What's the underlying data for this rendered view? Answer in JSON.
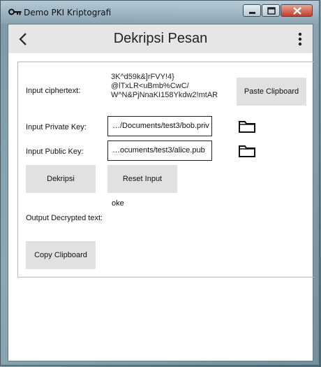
{
  "window": {
    "title": "Demo PKI Kriptografi"
  },
  "appbar": {
    "title": "Dekripsi Pesan",
    "back_icon": "arrow-left-icon",
    "menu_icon": "more-vertical-icon"
  },
  "form": {
    "ciphertext_label": "Input ciphertext:",
    "ciphertext_lines": [
      "3K^d59k&]rFVY!4}",
      "@lTxLR<uBmb%CwC/",
      "W^N&PjNnaKI158Ykdw2!mtAR"
    ],
    "paste_button": "Paste Clipboard",
    "private_key_label": "Input Private Key:",
    "private_key_value": "…/Documents/test3/bob.priv",
    "public_key_label": "Input Public Key:",
    "public_key_value": "…ocuments/test3/alice.pub",
    "decrypt_button": "Dekripsi",
    "reset_button": "Reset Input",
    "status_text": "oke",
    "output_label": "Output Decrypted text:",
    "copy_button": "Copy Clipboard"
  },
  "colors": {
    "button_bg": "#e1e1e1",
    "appbar_bg": "#e6e6e6"
  }
}
